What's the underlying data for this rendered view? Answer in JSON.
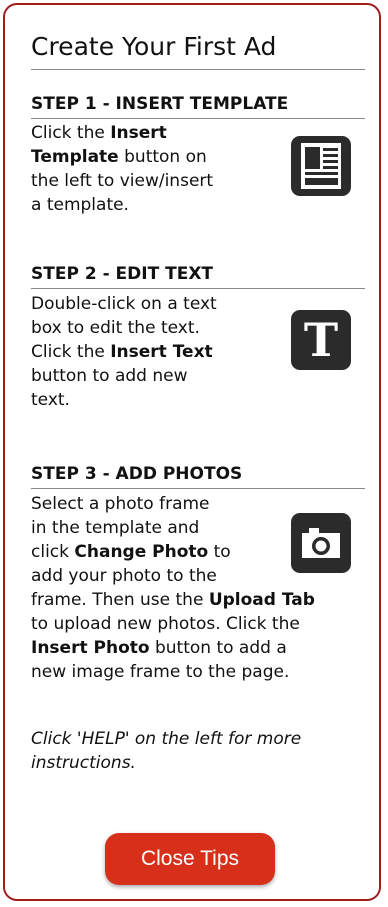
{
  "panel": {
    "title": "Create Your First Ad"
  },
  "steps": [
    {
      "heading": "STEP 1 - INSERT TEMPLATE",
      "lines": [
        [
          {
            "t": "Click the "
          },
          {
            "t": "Insert",
            "b": true
          }
        ],
        [
          {
            "t": "Template",
            "b": true
          },
          {
            "t": " button on"
          }
        ],
        [
          {
            "t": "the left to view/insert"
          }
        ],
        [
          {
            "t": "a template."
          }
        ]
      ],
      "icon": "template-icon"
    },
    {
      "heading": "STEP 2 - EDIT TEXT",
      "lines": [
        [
          {
            "t": "Double-click on a text"
          }
        ],
        [
          {
            "t": "box to edit the text."
          }
        ],
        [
          {
            "t": "Click the "
          },
          {
            "t": "Insert Text",
            "b": true
          }
        ],
        [
          {
            "t": "button to add new"
          }
        ],
        [
          {
            "t": "text."
          }
        ]
      ],
      "icon": "text-icon",
      "icon_glyph": "T"
    },
    {
      "heading": "STEP 3 - ADD PHOTOS",
      "lines": [
        [
          {
            "t": "Select a photo frame"
          }
        ],
        [
          {
            "t": "in the template and"
          }
        ],
        [
          {
            "t": "click "
          },
          {
            "t": "Change Photo",
            "b": true
          },
          {
            "t": " to"
          }
        ],
        [
          {
            "t": "add your photo to the"
          }
        ],
        [
          {
            "t": "frame. Then use the "
          },
          {
            "t": "Upload Tab",
            "b": true
          }
        ],
        [
          {
            "t": "to upload new photos. Click the"
          }
        ],
        [
          {
            "t": "Insert Photo",
            "b": true
          },
          {
            "t": " button to add a"
          }
        ],
        [
          {
            "t": "new image frame to the page."
          }
        ]
      ],
      "icon": "camera-icon"
    }
  ],
  "note": {
    "lines": [
      "Click 'HELP' on the left for more",
      "instructions."
    ]
  },
  "close_button": {
    "label": "Close Tips"
  },
  "colors": {
    "border": "#a01c1c",
    "button": "#d6301b",
    "icon_bg": "#2b2b2b"
  }
}
